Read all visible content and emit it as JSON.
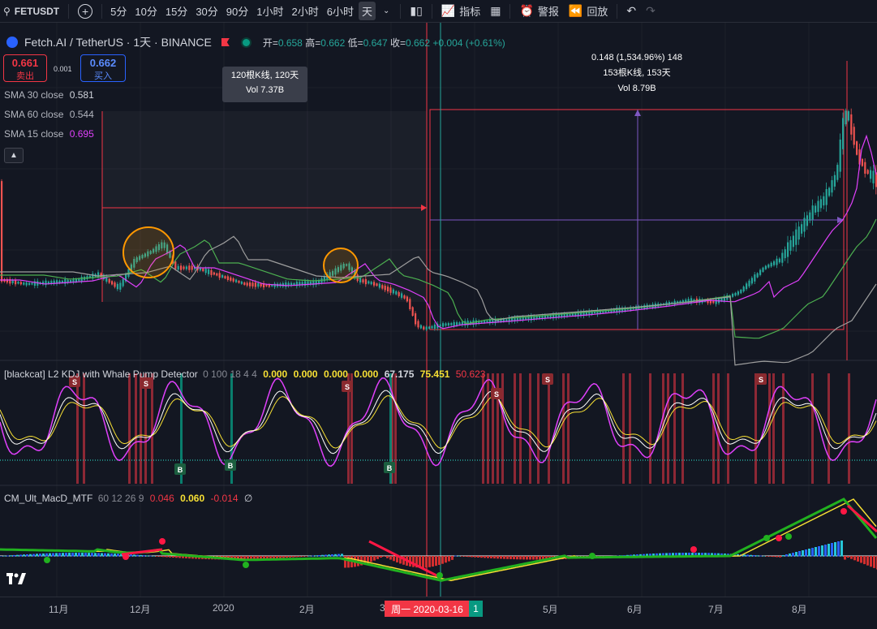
{
  "toolbar": {
    "symbol": "FETUSDT",
    "add_icon": "+",
    "intervals": [
      "5分",
      "10分",
      "15分",
      "30分",
      "90分",
      "1小时",
      "2小时",
      "6小时",
      "天"
    ],
    "active_interval": 8,
    "indicators_label": "指标",
    "alert_label": "警报",
    "replay_label": "回放",
    "icons": {
      "chart_type": "candles-icon",
      "indicators": "chart-line-icon",
      "layout": "grid-icon",
      "alert": "alarm-clock-icon",
      "replay": "rewind-icon",
      "undo": "undo-icon",
      "redo": "redo-icon"
    }
  },
  "legend": {
    "title": "Fetch.AI / TetherUS · 1天 · BINANCE",
    "open_k": "开=",
    "open_v": "0.658",
    "high_k": "高=",
    "high_v": "0.662",
    "low_k": "低=",
    "low_v": "0.647",
    "close_k": "收=",
    "close_v": "0.662",
    "change": "+0.004 (+0.61%)"
  },
  "trade": {
    "sell_price": "0.661",
    "sell_label": "卖出",
    "spread": "0.001",
    "buy_price": "0.662",
    "buy_label": "买入"
  },
  "sma": [
    {
      "label": "SMA 30 close",
      "value": "0.581",
      "color": "#d1d4dc"
    },
    {
      "label": "SMA 60 close",
      "value": "0.544",
      "color": "#b2b5be"
    },
    {
      "label": "SMA 15 close",
      "value": "0.695",
      "color": "#e040fb"
    }
  ],
  "tooltip": {
    "line1": "120根K线, 120天",
    "line2": "Vol 7.37B"
  },
  "measure": {
    "line1": "0.148 (1,534.96%) 148",
    "line2": "153根K线, 153天",
    "line3": "Vol 8.79B"
  },
  "kdj": {
    "name": "[blackcat] L2 KDJ with Whale Pump Detector",
    "params": "0 100 18 4 4",
    "v1": "0.000",
    "v2": "0.000",
    "v3": "0.000",
    "v4": "0.000",
    "v5": "67.175",
    "v6": "75.451",
    "v7": "50.623",
    "markers": {
      "buy": "B",
      "sell": "S"
    }
  },
  "macd": {
    "name": "CM_Ult_MacD_MTF",
    "params": "60 12 26 9",
    "v1": "0.046",
    "v2": "0.060",
    "v3": "-0.014",
    "v4": "∅"
  },
  "time_axis": {
    "labels": [
      "11月",
      "12月",
      "2020",
      "2月",
      "3",
      "5月",
      "6月",
      "7月",
      "8月"
    ],
    "cursor_date": "周一 2020-03-16",
    "cursor_extra": "1"
  },
  "colors": {
    "up": "#26a69a",
    "down": "#ef5350",
    "bg": "#131722",
    "accent": "#2962ff"
  }
}
